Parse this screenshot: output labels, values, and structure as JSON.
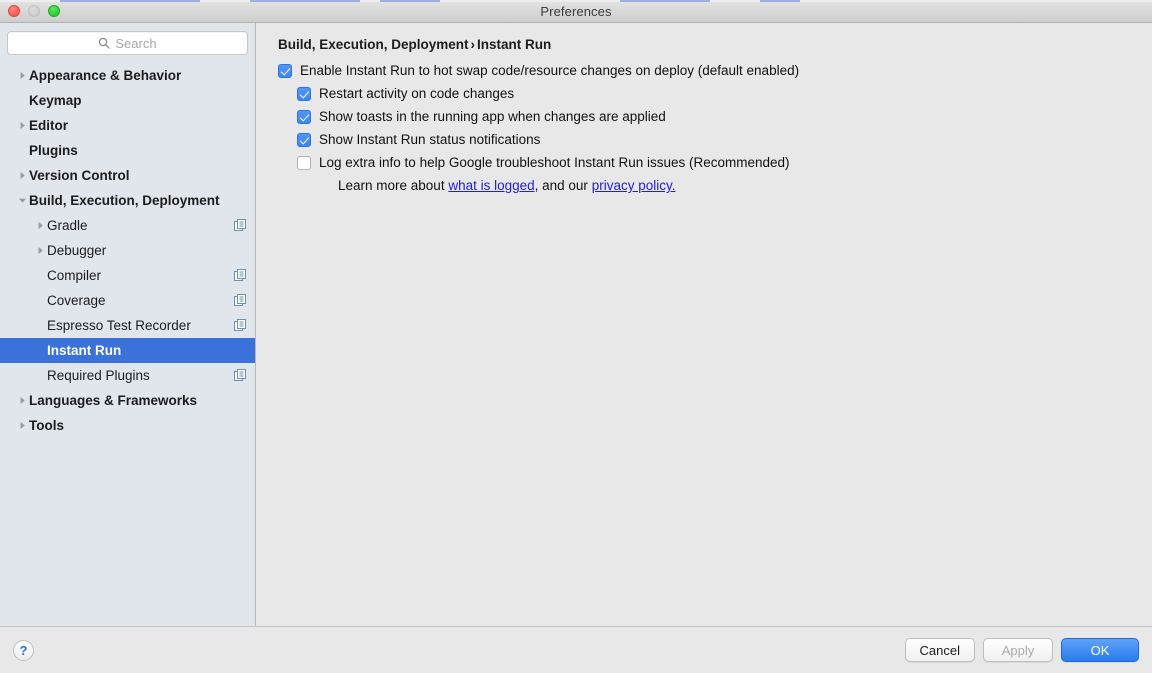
{
  "window": {
    "title": "Preferences",
    "controls": [
      {
        "name": "close",
        "label": "close"
      },
      {
        "name": "minimize",
        "label": "minimize"
      },
      {
        "name": "zoom",
        "label": "zoom"
      }
    ]
  },
  "colors": {
    "selection_blue": "#3b72d9",
    "checkbox_blue": "#3f86f2",
    "link_blue": "#2020d0",
    "default_button_blue": "#2a7bf0",
    "sidebar_bg": "#e1e5ec",
    "panel_bg": "#e8e8e8"
  },
  "search": {
    "placeholder": "Search",
    "value": "",
    "icon": "search-icon"
  },
  "sidebar": {
    "items": [
      {
        "label": "Appearance & Behavior",
        "level": 0,
        "twisty": "collapsed",
        "selected": false,
        "badge": false
      },
      {
        "label": "Keymap",
        "level": 0,
        "twisty": "none",
        "selected": false,
        "badge": false
      },
      {
        "label": "Editor",
        "level": 0,
        "twisty": "collapsed",
        "selected": false,
        "badge": false
      },
      {
        "label": "Plugins",
        "level": 0,
        "twisty": "none",
        "selected": false,
        "badge": false
      },
      {
        "label": "Version Control",
        "level": 0,
        "twisty": "collapsed",
        "selected": false,
        "badge": false
      },
      {
        "label": "Build, Execution, Deployment",
        "level": 0,
        "twisty": "expanded",
        "selected": false,
        "badge": false
      },
      {
        "label": "Gradle",
        "level": 1,
        "twisty": "collapsed",
        "selected": false,
        "badge": true
      },
      {
        "label": "Debugger",
        "level": 1,
        "twisty": "collapsed",
        "selected": false,
        "badge": false
      },
      {
        "label": "Compiler",
        "level": 1,
        "twisty": "none",
        "selected": false,
        "badge": true
      },
      {
        "label": "Coverage",
        "level": 1,
        "twisty": "none",
        "selected": false,
        "badge": true
      },
      {
        "label": "Espresso Test Recorder",
        "level": 1,
        "twisty": "none",
        "selected": false,
        "badge": true
      },
      {
        "label": "Instant Run",
        "level": 1,
        "twisty": "none",
        "selected": true,
        "badge": false
      },
      {
        "label": "Required Plugins",
        "level": 1,
        "twisty": "none",
        "selected": false,
        "badge": true
      },
      {
        "label": "Languages & Frameworks",
        "level": 0,
        "twisty": "collapsed",
        "selected": false,
        "badge": false
      },
      {
        "label": "Tools",
        "level": 0,
        "twisty": "collapsed",
        "selected": false,
        "badge": false
      }
    ]
  },
  "main": {
    "breadcrumb": {
      "parent": "Build, Execution, Deployment",
      "separator": "›",
      "current": "Instant Run"
    },
    "options": [
      {
        "label": "Enable Instant Run to hot swap code/resource changes on deploy (default enabled)",
        "checked": true,
        "indent": false
      },
      {
        "label": "Restart activity on code changes",
        "checked": true,
        "indent": true
      },
      {
        "label": "Show toasts in the running app when changes are applied",
        "checked": true,
        "indent": true
      },
      {
        "label": "Show Instant Run status notifications",
        "checked": true,
        "indent": true
      },
      {
        "label": "Log extra info to help Google troubleshoot Instant Run issues (Recommended)",
        "checked": false,
        "indent": true
      }
    ],
    "learn_more": {
      "prefix": "Learn more about ",
      "link1": "what is logged",
      "middle": ", and our ",
      "link2": "privacy policy.",
      "suffix": ""
    }
  },
  "bottom_bar": {
    "help_label": "?",
    "buttons": [
      {
        "label": "Cancel",
        "style": "normal"
      },
      {
        "label": "Apply",
        "style": "disabled"
      },
      {
        "label": "OK",
        "style": "default"
      }
    ]
  }
}
